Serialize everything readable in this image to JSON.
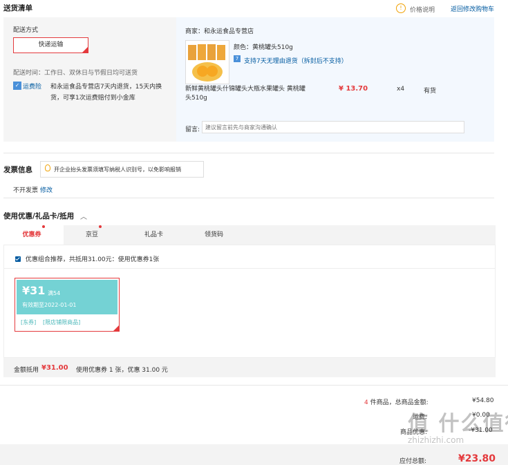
{
  "header": {
    "title": "送货清单",
    "price_note": "价格说明",
    "back_to_cart": "返回修改购物车"
  },
  "delivery": {
    "label": "配送方式",
    "method": "快递运输",
    "time": "配送时间：工作日、双休日与节假日均可送货",
    "insurance_label": "运费险",
    "insurance_text_1": "和永运食品专营店7天内退货，15天内换",
    "insurance_text_2": "货，可享1次运费赔付到小金库"
  },
  "shop": {
    "merchant": "商家：和永运食品专营店",
    "product_name_1": "新鲜黄桃罐头什锦罐头大瓶水果罐头 黄桃罐",
    "product_name_2": "头510g",
    "color": "颜色：黄桃罐头510g",
    "return_policy": "支持7天无理由退货（拆封后不支持）",
    "price": "¥ 13.70",
    "qty": "x4",
    "stock": "有货",
    "message_label": "留言:",
    "message_placeholder": "建议留言前先与商家沟通确认"
  },
  "invoice": {
    "title": "发票信息",
    "tip": "开企业抬头发票须填写纳税人识别号，以免影响报销",
    "status": "不开发票",
    "edit": "修改"
  },
  "coupons": {
    "title": "使用优惠/礼品卡/抵用",
    "tabs": [
      "优惠券",
      "京豆",
      "礼品卡",
      "领货码"
    ],
    "recommend": "优惠组合推荐，共抵用31.00元：使用优惠券1张",
    "coupon_amount": "¥31",
    "coupon_condition": "满54",
    "coupon_expiry": "有效期至2022-01-01",
    "coupon_tag1": "[东券]",
    "coupon_tag2": "[限店铺限商品]"
  },
  "summary": {
    "label": "金额抵用",
    "amount": "¥31.00",
    "desc": "使用优惠券 1 张，优惠 31.00 元"
  },
  "totals": {
    "item_count": "4",
    "items_label": "件商品，总商品金额:",
    "items_total": "¥54.80",
    "freight_label": "运费:",
    "freight": "¥0.00",
    "discount_label": "商品优惠:",
    "discount": "-¥31.00",
    "payable_label": "应付总额:",
    "payable": "¥23.80"
  },
  "watermark": "值 什么值得买",
  "watermark_url": "zhizhizhi.com"
}
